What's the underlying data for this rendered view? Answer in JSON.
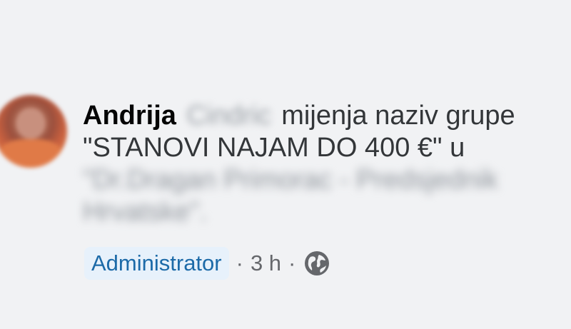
{
  "post": {
    "author_first_name": "Andrija",
    "author_last_name": "Cindric",
    "action_text": "mijenja naziv grupe",
    "old_group_name": "\"STANOVI NAJAM DO 400 €\"",
    "connector": "u",
    "new_group_name_line1": "\"Dr.Dragan Primorac - Predsjednik",
    "new_group_name_line2": "Hrvatske\"."
  },
  "meta": {
    "role_badge": "Administrator",
    "separator": "·",
    "time": "3 h",
    "privacy_icon": "globe-icon"
  },
  "colors": {
    "badge_bg": "#e7f1fb",
    "badge_text": "#1c6aa8",
    "meta_text": "#65676b",
    "body_text": "#333639",
    "background": "#f1f2f4"
  }
}
